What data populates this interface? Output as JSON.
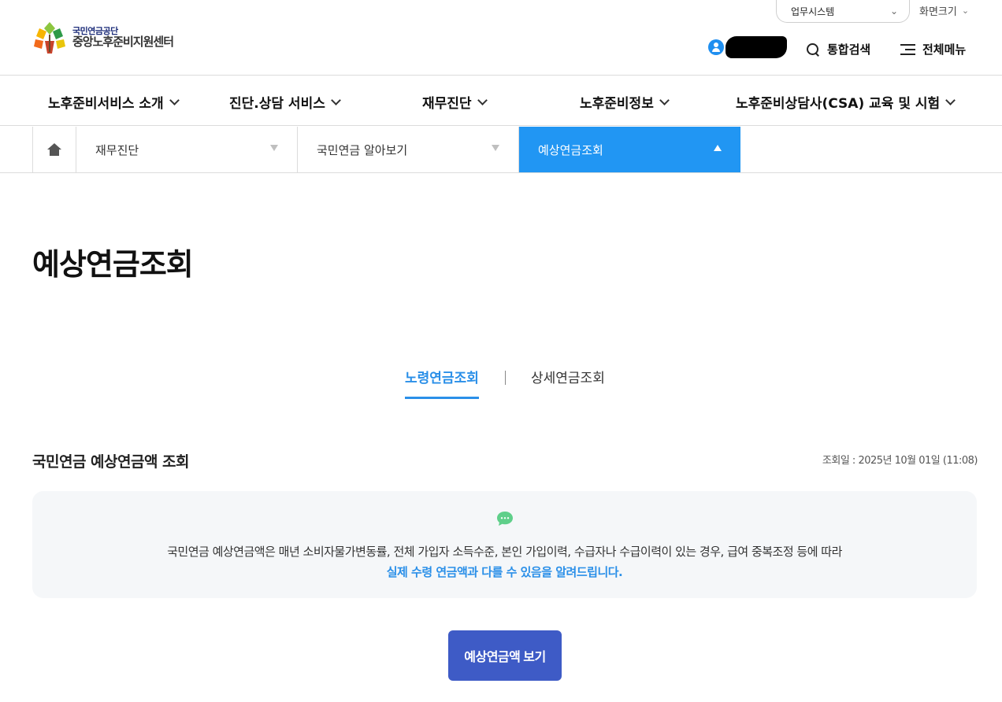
{
  "header": {
    "logo": {
      "line1": "국민연금공단",
      "line2": "중앙노후준비지원센터"
    },
    "system_select": {
      "label": "업무시스템"
    },
    "zoom_label": "화면크기",
    "search_label": "통합검색",
    "menu_label": "전체메뉴"
  },
  "gnb": {
    "items": [
      {
        "label": "노후준비서비스 소개"
      },
      {
        "label": "진단.상담 서비스"
      },
      {
        "label": "재무진단"
      },
      {
        "label": "노후준비정보"
      },
      {
        "label": "노후준비상담사(CSA) 교육 및 시험"
      }
    ]
  },
  "location": {
    "segments": [
      {
        "label": "재무진단"
      },
      {
        "label": "국민연금 알아보기"
      },
      {
        "label": "예상연금조회"
      }
    ],
    "active_color": "#2196f3"
  },
  "page": {
    "title": "예상연금조회"
  },
  "tabs": [
    {
      "label": "노령연금조회",
      "active": true
    },
    {
      "label": "상세연금조회",
      "active": false
    }
  ],
  "section": {
    "title": "국민연금 예상연금액 조회",
    "date": "조회일 : 2025년 10월 01일 (11:08)"
  },
  "notice": {
    "line1": "국민연금 예상연금액은 매년 소비자물가변동률, 전체 가입자 소득수준, 본인 가입이력, 수급자나 수급이력이 있는 경우, 급여 중복조정 등에 따라",
    "line2": "실제 수령 연금액과 다를 수 있음을 알려드립니다.",
    "icon": "chat-bubble-icon"
  },
  "actions": {
    "view_button": "예상연금액 보기"
  },
  "colors": {
    "accent": "#2a8fe8",
    "primary_button": "#3e5bc6",
    "notice_bg": "#f5f7f9"
  }
}
